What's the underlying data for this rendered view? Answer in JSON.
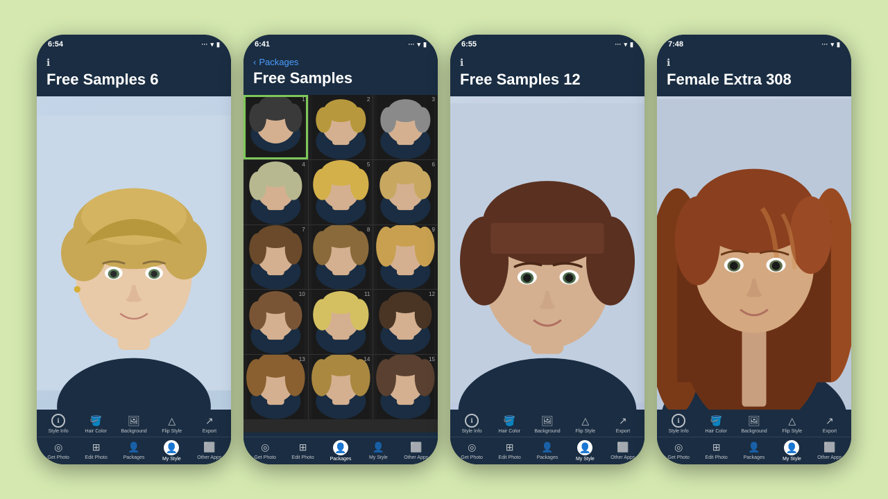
{
  "page": {
    "background": "#d4e8b0"
  },
  "phones": [
    {
      "id": "phone1",
      "time": "6:54",
      "header_icon": "ℹ",
      "title": "Free Samples 6",
      "style": "portrait",
      "toolbar_top": [
        "Style Info",
        "Hair Color",
        "Background",
        "Flip Style",
        "Export"
      ],
      "toolbar_bottom": [
        "Get Photo",
        "Edit Photo",
        "Packages",
        "My Style",
        "Other Apps"
      ],
      "active_bottom": "My Style"
    },
    {
      "id": "phone2",
      "time": "6:41",
      "back_label": "Packages",
      "header_icon": null,
      "title": "Free Samples",
      "style": "grid",
      "grid_count": 15,
      "selected_cell": 1,
      "toolbar_top": [],
      "toolbar_bottom": [
        "Get Photo",
        "Edit Photo",
        "Packages",
        "My Style",
        "Other Apps"
      ],
      "active_bottom": "Packages"
    },
    {
      "id": "phone3",
      "time": "6:55",
      "header_icon": "ℹ",
      "title": "Free Samples 12",
      "style": "portrait_bob",
      "toolbar_top": [
        "Style Info",
        "Hair Color",
        "Background",
        "Flip Style",
        "Export"
      ],
      "toolbar_bottom": [
        "Get Photo",
        "Edit Photo",
        "Packages",
        "My Style",
        "Other Apps"
      ],
      "active_bottom": "My Style"
    },
    {
      "id": "phone4",
      "time": "7:48",
      "header_icon": "ℹ",
      "title": "Female Extra 308",
      "style": "portrait_long",
      "toolbar_top": [
        "Style Info",
        "Hair Color",
        "Background",
        "Flip Style",
        "Export"
      ],
      "toolbar_bottom": [
        "Get Photo",
        "Edit Photo",
        "Packages",
        "My Style",
        "Other Apps"
      ],
      "active_bottom": "My Style"
    }
  ],
  "icons": {
    "style_info": "ℹ",
    "hair_color": "🪣",
    "background": "🖼",
    "flip_style": "⛵",
    "export": "↗",
    "get_photo": "📷",
    "edit_photo": "⊞",
    "packages": "👤",
    "my_style": "👤",
    "other_apps": "⬜"
  }
}
